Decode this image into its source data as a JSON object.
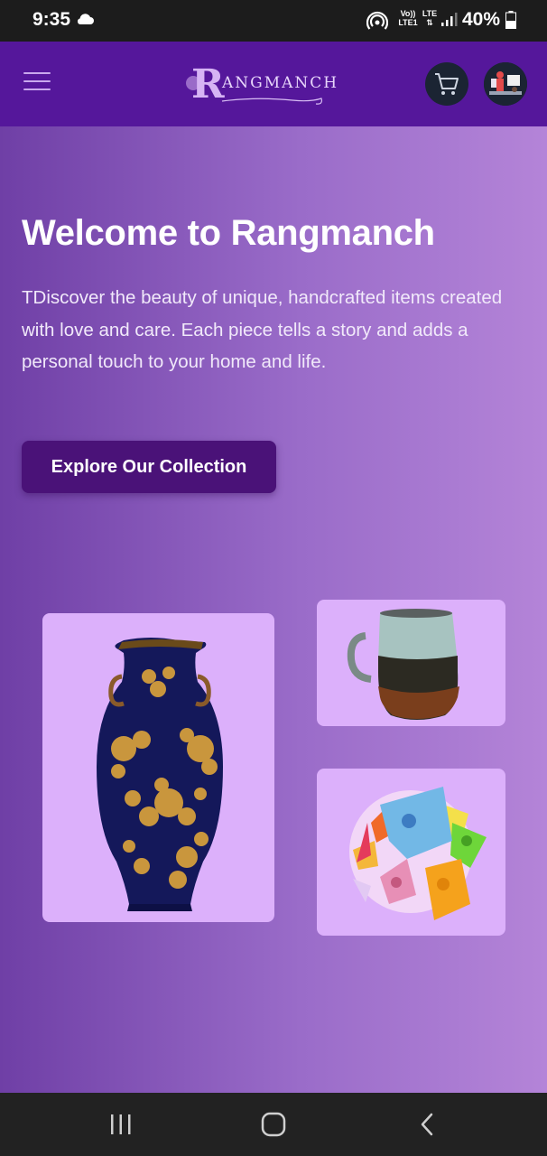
{
  "status": {
    "time": "9:35",
    "volte_top": "Vo))",
    "volte_bottom": "LTE1",
    "lte": "LTE",
    "battery": "40%",
    "icons": [
      "cloud-icon",
      "hotspot-icon",
      "signal-icon",
      "battery-icon"
    ]
  },
  "header": {
    "logo_letter": "R",
    "logo_text": "ANGMANCH",
    "icons": [
      "menu-icon",
      "cart-icon",
      "avatar"
    ]
  },
  "hero": {
    "title": "Welcome to Rangmanch",
    "description": "TDiscover the beauty of unique, handcrafted items created with love and care. Each piece tells a story and adds a personal touch to your home and life.",
    "cta_label": "Explore Our Collection"
  },
  "products": [
    "vase-image",
    "mug-image",
    "paper-flower-image"
  ],
  "nav": {
    "icons": [
      "recents-icon",
      "home-icon",
      "back-icon"
    ]
  },
  "colors": {
    "header_bg": "#55179b",
    "button_bg": "#4a1278",
    "card_bg": "#dcb0fb"
  }
}
